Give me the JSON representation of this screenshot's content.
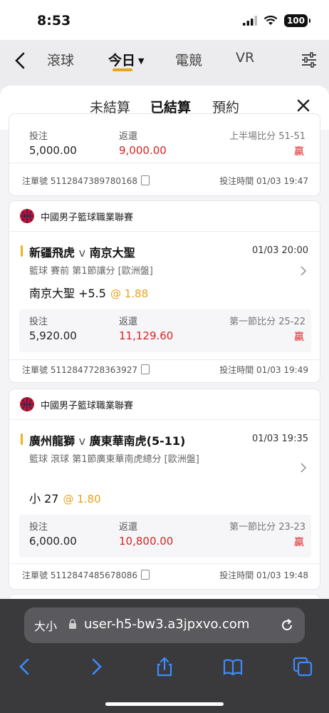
{
  "status": {
    "time": "8:53",
    "battery": "100"
  },
  "nav": {
    "tabs": [
      "滾球",
      "今日",
      "電競",
      "VR"
    ]
  },
  "sheet": {
    "tabs": [
      "未結算",
      "已結算",
      "預約"
    ]
  },
  "cards": [
    {
      "stake_label": "投注",
      "stake": "5,000.00",
      "return_label": "返還",
      "return": "9,000.00",
      "score": "上半場比分 51-51",
      "result": "贏",
      "ticket": "注單號 5112847389780168",
      "bet_time": "投注時間 01/03 19:47"
    },
    {
      "league": "中國男子籃球職業聯賽",
      "home": "新疆飛虎",
      "vs": "v",
      "away": "南京大聖",
      "match_time": "01/03 20:00",
      "market": "籃球 賽前   第1節讓分 [歐洲盤]",
      "selection": "南京大聖 +5.5",
      "odds": "@ 1.88",
      "stake_label": "投注",
      "stake": "5,920.00",
      "return_label": "返還",
      "return": "11,129.60",
      "score": "第一節比分 25-22",
      "result": "贏",
      "ticket": "注單號 5112847728363927",
      "bet_time": "投注時間 01/03 19:49"
    },
    {
      "league": "中國男子籃球職業聯賽",
      "home": "廣州龍獅",
      "vs": "v",
      "away": "廣東華南虎(5-11)",
      "match_time": "01/03 19:35",
      "market": "籃球 滾球   第1節廣東華南虎總分 [歐洲盤]",
      "selection": "小 27",
      "odds": "@ 1.80",
      "stake_label": "投注",
      "stake": "6,000.00",
      "return_label": "返還",
      "return": "10,800.00",
      "score": "第一節比分 23-23",
      "result": "贏",
      "ticket": "注單號 5112847485678086",
      "bet_time": "投注時間 01/03 19:48"
    }
  ],
  "browser": {
    "text_size": "大小",
    "url": "user-h5-bw3.a3jpxvo.com"
  },
  "colors": {
    "accent": "#e8a317",
    "win": "#dd2222"
  }
}
